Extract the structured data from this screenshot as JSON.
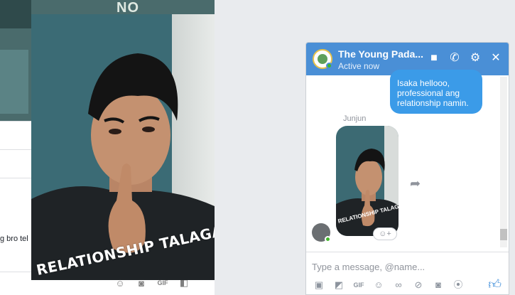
{
  "background_feed": {
    "banner_label": "NO",
    "input_snippet": "g bro tel",
    "toolbar_icons": [
      "emoji-icon",
      "camera-icon",
      "gif-icon",
      "sticker-icon"
    ]
  },
  "photo_viewer": {
    "caption": "RELATIONSHIP TALAGA?"
  },
  "chat": {
    "title": "The Young Pada...",
    "status": "Active now",
    "header_icons": [
      "video-call-icon",
      "phone-icon",
      "gear-icon",
      "close-icon"
    ],
    "outgoing_message": "Isaka hellooo, professional ang relationship namin.",
    "sender_name": "Junjun",
    "image_caption": "RELATIONSHIP TALAGA?",
    "composer_placeholder": "Type a message, @name...",
    "composer_tools": [
      "photo-icon",
      "sticker-icon",
      "gif-icon",
      "emoji-icon",
      "link-icon",
      "attachment-icon",
      "camera-icon",
      "voice-icon"
    ],
    "accent_color": "#4a8fd6",
    "bubble_color": "#3b9be8"
  }
}
